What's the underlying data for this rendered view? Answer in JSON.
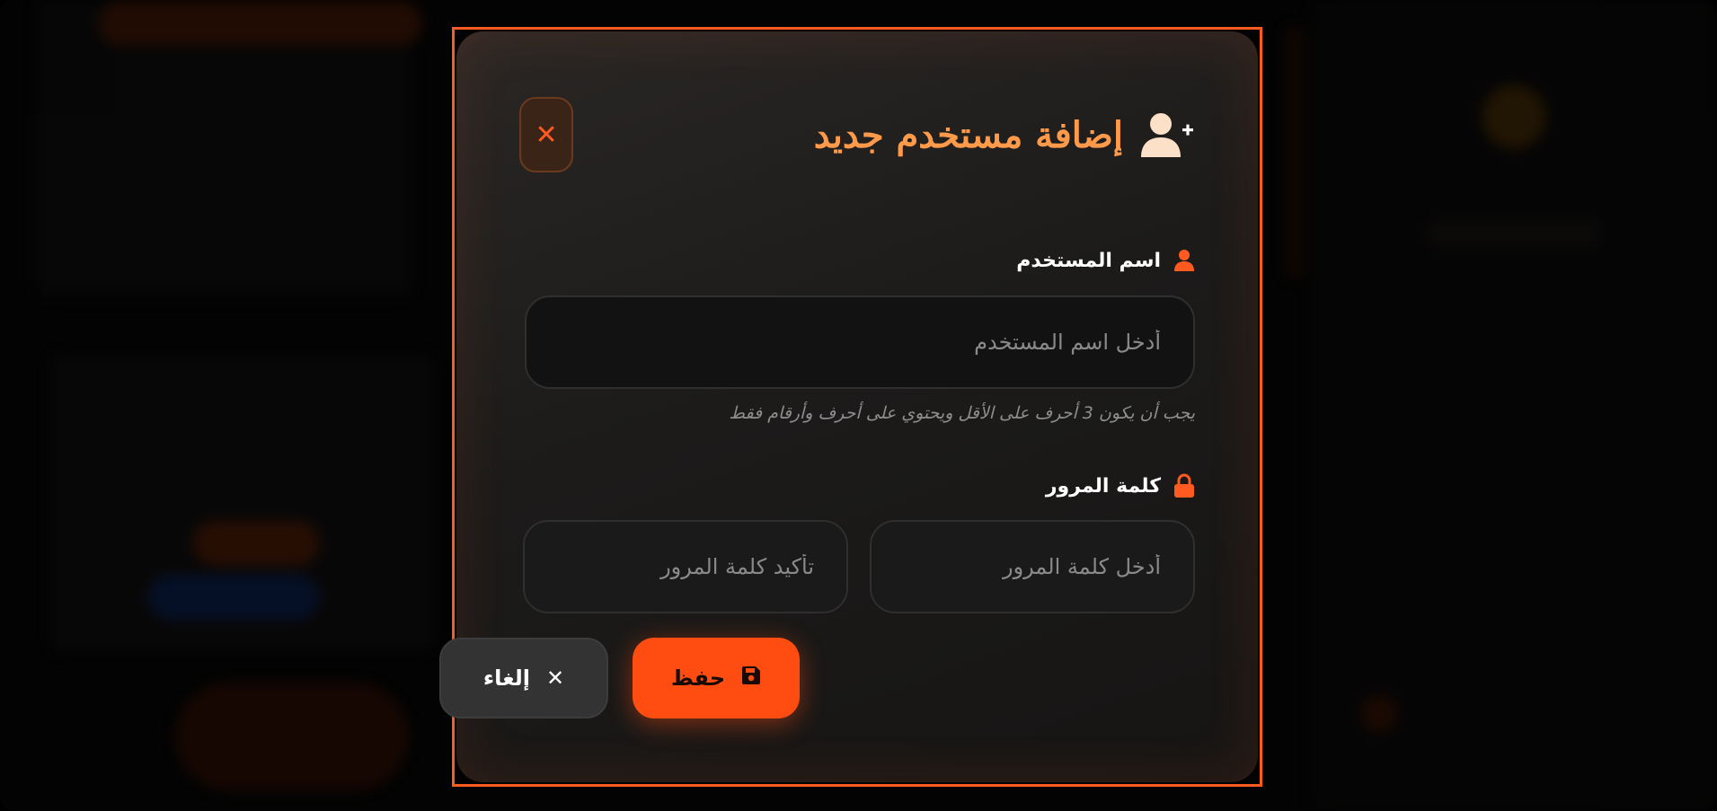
{
  "modal": {
    "title": "إضافة مستخدم جديد",
    "close_symbol": "✕",
    "username": {
      "label": "اسم المستخدم",
      "placeholder": "أدخل اسم المستخدم",
      "value": "",
      "hint": "يجب أن يكون 3 أحرف على الأقل ويحتوي على أحرف وأرقام فقط"
    },
    "password": {
      "label": "كلمة المرور",
      "placeholder": "أدخل كلمة المرور",
      "confirm_placeholder": "تأكيد كلمة المرور"
    },
    "buttons": {
      "save_label": "حفظ",
      "cancel_label": "إلغاء",
      "cancel_symbol": "✕"
    }
  },
  "icons": {
    "title": "user-plus-icon",
    "close": "close-icon",
    "username_label": "user-icon",
    "password_label": "lock-icon",
    "save": "floppy-disk-icon",
    "cancel": "close-icon"
  },
  "colors": {
    "accent": "#ff4d12",
    "title": "#ff9a4a",
    "frame": "#ff5a1f"
  }
}
